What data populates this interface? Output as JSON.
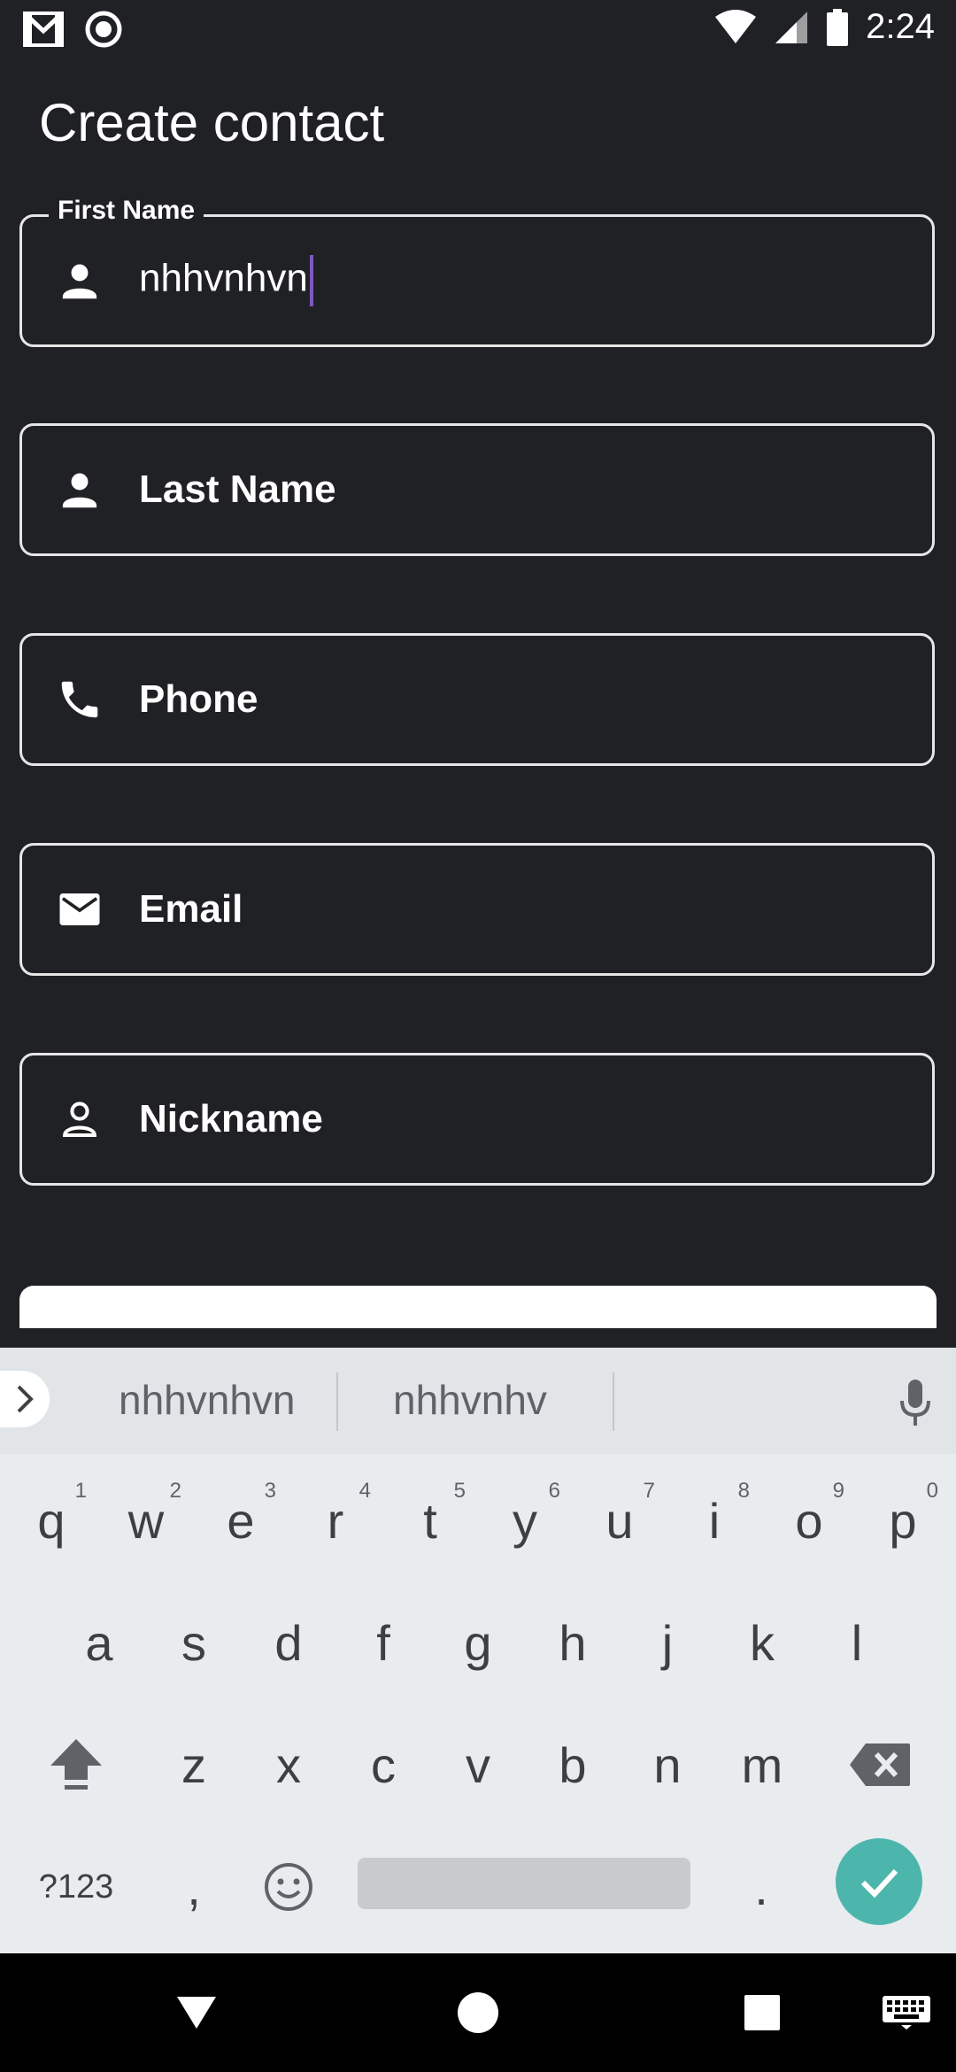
{
  "status_bar": {
    "time": "2:24",
    "icons": [
      "gmail-icon",
      "record-icon",
      "wifi-icon",
      "signal-icon",
      "battery-icon"
    ]
  },
  "header": {
    "title": "Create contact"
  },
  "form": {
    "first_name": {
      "label": "First Name",
      "value": "nhhvnhvn",
      "icon": "person-icon"
    },
    "last_name": {
      "placeholder": "Last Name",
      "icon": "person-icon"
    },
    "phone": {
      "placeholder": "Phone",
      "icon": "phone-icon"
    },
    "email": {
      "placeholder": "Email",
      "icon": "mail-icon"
    },
    "nickname": {
      "placeholder": "Nickname",
      "icon": "person-outline-icon"
    }
  },
  "keyboard": {
    "suggestions": [
      "nhhvnhvn",
      "nhhvnhv"
    ],
    "row1": [
      {
        "key": "q",
        "hint": "1"
      },
      {
        "key": "w",
        "hint": "2"
      },
      {
        "key": "e",
        "hint": "3"
      },
      {
        "key": "r",
        "hint": "4"
      },
      {
        "key": "t",
        "hint": "5"
      },
      {
        "key": "y",
        "hint": "6"
      },
      {
        "key": "u",
        "hint": "7"
      },
      {
        "key": "i",
        "hint": "8"
      },
      {
        "key": "o",
        "hint": "9"
      },
      {
        "key": "p",
        "hint": "0"
      }
    ],
    "row2": [
      "a",
      "s",
      "d",
      "f",
      "g",
      "h",
      "j",
      "k",
      "l"
    ],
    "row3": [
      "z",
      "x",
      "c",
      "v",
      "b",
      "n",
      "m"
    ],
    "symbols_label": "?123",
    "comma": ",",
    "period": "."
  },
  "colors": {
    "background": "#202125",
    "caret": "#7e57c2",
    "enter_key": "#4db6ac",
    "keyboard_bg": "#e8ecef"
  }
}
